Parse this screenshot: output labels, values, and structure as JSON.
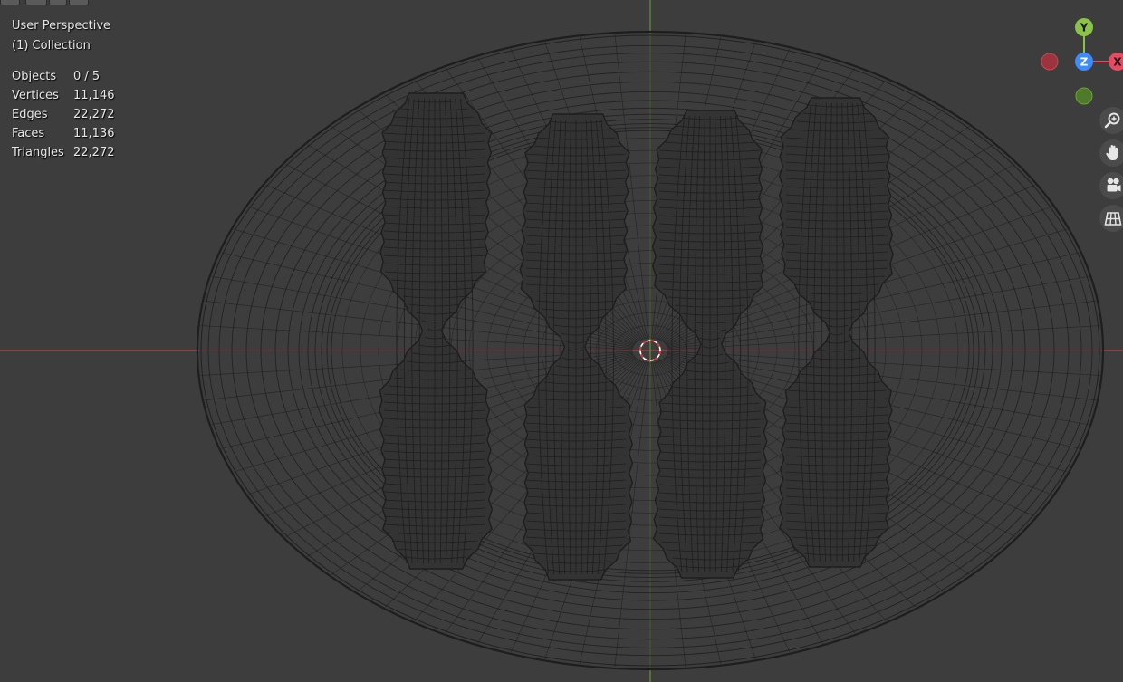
{
  "header": {
    "view_name": "User Perspective",
    "collection": "(1) Collection"
  },
  "stats": {
    "objects_label": "Objects",
    "objects_value": "0 / 5",
    "vertices_label": "Vertices",
    "vertices_value": "11,146",
    "edges_label": "Edges",
    "edges_value": "22,272",
    "faces_label": "Faces",
    "faces_value": "11,136",
    "triangles_label": "Triangles",
    "triangles_value": "22,272"
  },
  "gizmo": {
    "y_label": "Y",
    "z_label": "Z",
    "x_label": "X",
    "colors": {
      "x": "#e84a5f",
      "y": "#8bc34a",
      "z": "#3d8bfd"
    }
  },
  "nav_icons": [
    "zoom-icon",
    "hand-pan-icon",
    "camera-icon",
    "grid-ortho-icon"
  ],
  "colors": {
    "background": "#3d3d3d",
    "wire": "#1e1e1e",
    "x_axis": "#c9474e",
    "y_axis": "#6aa33a"
  }
}
